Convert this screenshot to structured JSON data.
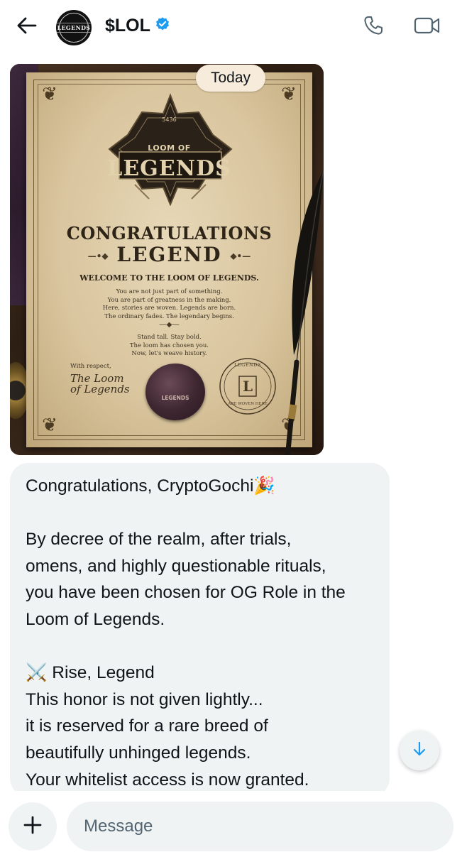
{
  "header": {
    "title": "$LOL",
    "avatar_text": "LEGENDS",
    "back_icon": "arrow-left-icon",
    "verified_icon": "verified-badge-icon",
    "call_icon": "phone-icon",
    "video_icon": "video-camera-icon",
    "verified_color": "#1d9bf0"
  },
  "conversation": {
    "date_separator": "Today",
    "image": {
      "emblem_year": "5436",
      "emblem_loom": "LOOM OF",
      "emblem_legends": "LEGENDS",
      "heading_1": "CONGRATULATIONS",
      "heading_2": "LEGEND",
      "welcome": "WELCOME TO THE LOOM OF LEGENDS.",
      "body_lines": [
        "You are not just part of something.",
        "You are part of greatness in the making.",
        "Here, stories are woven. Legends are born.",
        "The ordinary fades. The legendary begins."
      ],
      "closing_lines": [
        "Stand tall. Stay bold.",
        "The loom has chosen you.",
        "Now, let's weave history."
      ],
      "signoff": "With respect,",
      "signature_lines": [
        "The Loom",
        "of Legends"
      ],
      "seal_text": "LEGENDS",
      "stamp_top": "LEGENDS",
      "stamp_letter": "L",
      "stamp_bottom": "ARE WOVEN HERE"
    },
    "message_lines": [
      "Congratulations, CryptoGochi🎉",
      "",
      "By decree of the realm, after trials,",
      "omens, and highly questionable rituals,",
      "you have been chosen for OG Role in the",
      "Loom of Legends.",
      "",
      "⚔️ Rise, Legend",
      "This honor is not given lightly...",
      "it is reserved for a rare breed of",
      "beautifully unhinged legends.",
      "Your whitelist access is now granted."
    ]
  },
  "scroll_button": {
    "icon": "arrow-down-icon",
    "color": "#1d9bf0"
  },
  "composer": {
    "add_icon": "plus-icon",
    "placeholder": "Message"
  }
}
